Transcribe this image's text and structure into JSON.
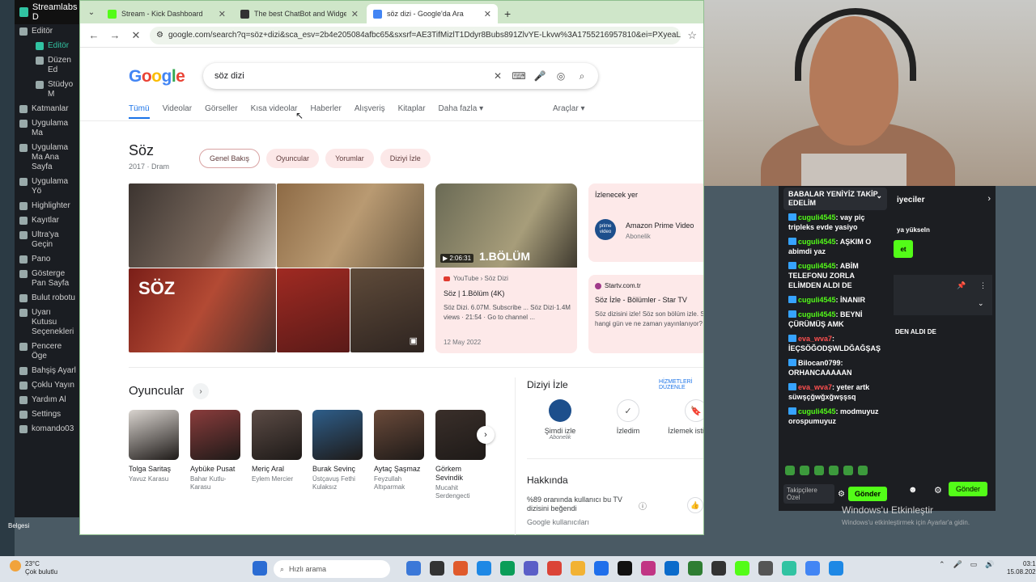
{
  "streamlabs": {
    "app_title": "Streamlabs D",
    "items": [
      {
        "label": "Editör",
        "type": "item"
      },
      {
        "label": "Editör",
        "type": "sub-active"
      },
      {
        "label": "Düzen Ed",
        "type": "sub"
      },
      {
        "label": "Stüdyo M",
        "type": "sub"
      },
      {
        "label": "Katmanlar",
        "type": "item"
      },
      {
        "label": "Uygulama Ma",
        "type": "item"
      },
      {
        "label": "Uygulama Ma Ana Sayfa",
        "type": "item"
      },
      {
        "label": "Uygulama Yö",
        "type": "item"
      },
      {
        "label": "Highlighter",
        "type": "item"
      },
      {
        "label": "Kayıtlar",
        "type": "item"
      },
      {
        "label": "Ultra'ya Geçin",
        "type": "item"
      },
      {
        "label": "Pano",
        "type": "item"
      },
      {
        "label": "Gösterge Pan Sayfa",
        "type": "item"
      },
      {
        "label": "Bulut robotu",
        "type": "item"
      },
      {
        "label": "Uyarı Kutusu Seçenekleri",
        "type": "item"
      },
      {
        "label": "Pencere Öge",
        "type": "item"
      },
      {
        "label": "Bahşiş Ayarl",
        "type": "item"
      },
      {
        "label": "Çoklu Yayın",
        "type": "item"
      },
      {
        "label": "Yardım Al",
        "type": "item"
      },
      {
        "label": "Settings",
        "type": "item"
      },
      {
        "label": "komando03",
        "type": "item"
      }
    ]
  },
  "browser": {
    "tabs": [
      {
        "title": "Stream - Kick Dashboard",
        "color": "#53fc18",
        "active": false
      },
      {
        "title": "The best ChatBot and Widgets",
        "color": "#333333",
        "active": false
      },
      {
        "title": "söz dizi - Google'da Ara",
        "color": "#4285f4",
        "active": true
      }
    ],
    "url": "google.com/search?q=söz+dizi&sca_esv=2b4e205084afbc65&sxsrf=AE3TifMizlT1Ddyr8Bubs891ZlvYE-Lkvw%3A1755216957810&ei=PXyeaLyYMfORx..."
  },
  "google": {
    "logo": "Google",
    "query": "söz dizi",
    "tabs": [
      "Tümü",
      "Videolar",
      "Görseller",
      "Kısa videolar",
      "Haberler",
      "Alışveriş",
      "Kitaplar",
      "Daha fazla ▾"
    ],
    "tools": "Araçlar ▾",
    "kp_title": "Söz",
    "kp_sub": "2017 · Dram",
    "chips": [
      "Genel Bakış",
      "Oyuncular",
      "Yorumlar",
      "Diziyi İzle"
    ],
    "poster_text": "SÖZ",
    "youtube": {
      "duration": "▶ 2:06:31",
      "episode_text": "1.BÖLÜM",
      "source": "YouTube › Söz Dizi",
      "title": "Söz | 1.Bölüm (4K)",
      "desc": "Söz Dizi. 6.07M. Subscribe ... Söz Dizi·1.4M views · 21:54 · Go to channel ...",
      "date": "12 May 2022"
    },
    "watch": {
      "heading": "İzlenecek yer",
      "provider": "Amazon Prime Video",
      "provider_logo": "prime video",
      "provider_sub": "Abonelik"
    },
    "startv": {
      "source": "Startv.com.tr",
      "title": "Söz İzle - Bölümler - Star TV",
      "desc": "Söz dizisini izle! Söz son bölüm izle. Söz hangi gün ve ne zaman yayınlanıyor? Söz..."
    },
    "cast_title": "Oyuncular",
    "cast": [
      {
        "name": "Tolga Saritaş",
        "role": "Yavuz Karasu",
        "color": "#d9d4cf"
      },
      {
        "name": "Aybüke Pusat",
        "role": "Bahar Kutlu-Karasu",
        "color": "#8a3c3c"
      },
      {
        "name": "Meriç Aral",
        "role": "Eylem Mercier",
        "color": "#5b4b45"
      },
      {
        "name": "Burak Sevinç",
        "role": "Üstçavuş Fethi Kulaksız",
        "color": "#2e5e8a"
      },
      {
        "name": "Aytaç Şaşmaz",
        "role": "Feyzullah Altıparmak",
        "color": "#6a4a3a"
      },
      {
        "name": "Görkem Sevindik",
        "role": "Mucahit Serdengecti",
        "color": "#3a2f2a"
      }
    ],
    "watch_title": "Diziyi İzle",
    "watch_edit": "HİZMETLERİ DÜZENLE",
    "watch_opts": [
      {
        "label": "Şimdi izle",
        "sub": "Abonelik",
        "icon": "prime"
      },
      {
        "label": "İzledim",
        "sub": "",
        "icon": "✓"
      },
      {
        "label": "İzlemek istiyorum",
        "sub": "",
        "icon": "🔖"
      }
    ],
    "about": "Hakkında",
    "like_text": "%89 oranında kullanıcı bu TV dizisini beğendi",
    "like_src": "Google kullanıcıları"
  },
  "chat": {
    "pinned": "BABALAR YENİYİZ TAKİP EDELİM",
    "messages": [
      {
        "user": "cuguli4545",
        "text": "vay piç tripleks evde yasiyo",
        "color": "green"
      },
      {
        "user": "cuguli4545",
        "text": "AŞKIM O abimdi yaz",
        "color": "green"
      },
      {
        "user": "cuguli4545",
        "text": "ABİM TELEFONU ZORLA ELİMDEN ALDI DE",
        "color": "green"
      },
      {
        "user": "cuguli4545",
        "text": "İNANIR",
        "color": "green"
      },
      {
        "user": "cuguli4545",
        "text": "BEYNİ ÇÜRÜMÜŞ AMK",
        "color": "green"
      },
      {
        "user": "eva_wva7",
        "text": "İEÇSÖĞODŞWLDĞAĞŞAŞ",
        "color": "red"
      },
      {
        "user": "Bilocan0799",
        "text": "ORHANCAAAAAN",
        "color": "plain"
      },
      {
        "user": "eva_wva7",
        "text": "yeter artk süwşçğwğxğwşşsq",
        "color": "red"
      },
      {
        "user": "cuguli4545",
        "text": "modmuyuz orospumuyuz",
        "color": "green"
      }
    ],
    "follow_label": "Takipçilere Özel",
    "send": "Gönder"
  },
  "chat2": {
    "head": "iyeciler",
    "line": "ya yükseln",
    "btn": "et",
    "text": "DEN ALDI DE",
    "send": "Gönder"
  },
  "windows": {
    "activate": "Windows'u Etkinleştir",
    "activate_sub": "Windows'u etkinleştirmek için Ayarlar'a gidin.",
    "desktop_label": "Belgesi"
  },
  "taskbar": {
    "weather_temp": "23°C",
    "weather_desc": "Çok bulutlu",
    "search_placeholder": "Hızlı arama",
    "time": "03:1",
    "date": "15.08.202",
    "apps": [
      "#3b78d8",
      "#333333",
      "#e05a2b",
      "#1e88e5",
      "#0a9d58",
      "#5b5fc7",
      "#db4437",
      "#f2b233",
      "#1f6feb",
      "#111111",
      "#c13584",
      "#0b6bcb",
      "#2e7d32",
      "#333333",
      "#53fc18",
      "#555555",
      "#31c3a2",
      "#4285f4",
      "#1e88e5"
    ]
  }
}
